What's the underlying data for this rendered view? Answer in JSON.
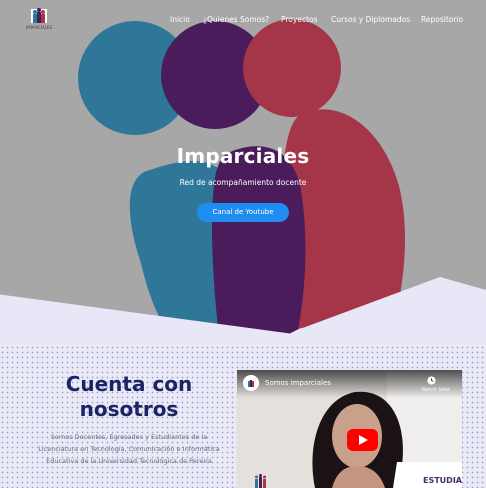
{
  "logo": {
    "text": "IMPARCIALES"
  },
  "nav": {
    "items": [
      "Inicio",
      "¿Quienes Somos?",
      "Proyectos",
      "Cursos y Diplomados",
      "Repositorio"
    ]
  },
  "hero": {
    "title": "Imparciales",
    "subtitle": "Red de acompañamiento docente",
    "cta_label": "Canal de Youtube"
  },
  "section": {
    "title_line1": "Cuenta con",
    "title_line2": "nosotros",
    "description": "Somos Docentes, Egresados y Estudiantes de la Licenciatura en Tecnología, Comunicación e Informática Educativa de la Universidad Tecnológica de Pereira"
  },
  "video": {
    "title": "Somos imparciales",
    "watch_later": "Watch later",
    "brand_text": "ESTUDIAN"
  },
  "colors": {
    "teal": "#2f7799",
    "purple": "#4b1c5c",
    "crimson": "#a5364a",
    "hero_bg": "#a7a7a7",
    "cta": "#1f8cf0",
    "heading": "#1b2566",
    "wedge": "#e8e7f7"
  }
}
